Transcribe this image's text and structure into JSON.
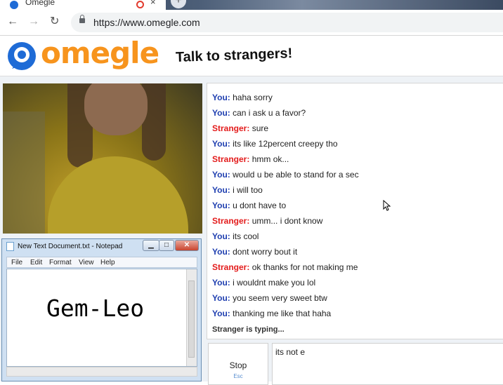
{
  "browser": {
    "tab_title": "Omegle",
    "new_tab_label": "+",
    "close_label": "×",
    "back_label": "←",
    "forward_label": "→",
    "reload_label": "↻",
    "url": "https://www.omegle.com"
  },
  "header": {
    "logo_text": "omegle",
    "tagline": "Talk to strangers!"
  },
  "notepad": {
    "title": "New Text Document.txt - Notepad",
    "minimize_label": "▁",
    "maximize_label": "□",
    "close_label": "✕",
    "menu": [
      "File",
      "Edit",
      "Format",
      "View",
      "Help"
    ],
    "content": "Gem-Leo"
  },
  "chat": {
    "messages": [
      {
        "speaker": "You:",
        "text": "haha sorry"
      },
      {
        "speaker": "You:",
        "text": "can i ask u a favor?"
      },
      {
        "speaker": "Stranger:",
        "text": "sure"
      },
      {
        "speaker": "You:",
        "text": "its like 12percent creepy tho"
      },
      {
        "speaker": "Stranger:",
        "text": "hmm ok..."
      },
      {
        "speaker": "You:",
        "text": "would u be able to stand for a sec"
      },
      {
        "speaker": "You:",
        "text": "i will too"
      },
      {
        "speaker": "You:",
        "text": "u dont have to"
      },
      {
        "speaker": "Stranger:",
        "text": "umm... i dont know"
      },
      {
        "speaker": "You:",
        "text": "its cool"
      },
      {
        "speaker": "You:",
        "text": "dont worry bout it"
      },
      {
        "speaker": "Stranger:",
        "text": "ok thanks for not making me"
      },
      {
        "speaker": "You:",
        "text": "i wouldnt make you lol"
      },
      {
        "speaker": "You:",
        "text": "you seem very sweet btw"
      },
      {
        "speaker": "You:",
        "text": "thanking me like that haha"
      }
    ],
    "typing_status": "Stranger is typing...",
    "stop_label": "Stop",
    "stop_key": "Esc",
    "input_value": "its not e"
  },
  "colors": {
    "you": "#1f3fb0",
    "stranger": "#e31b1b",
    "logo_orange": "#f7941d",
    "logo_blue": "#1e6bd6"
  }
}
